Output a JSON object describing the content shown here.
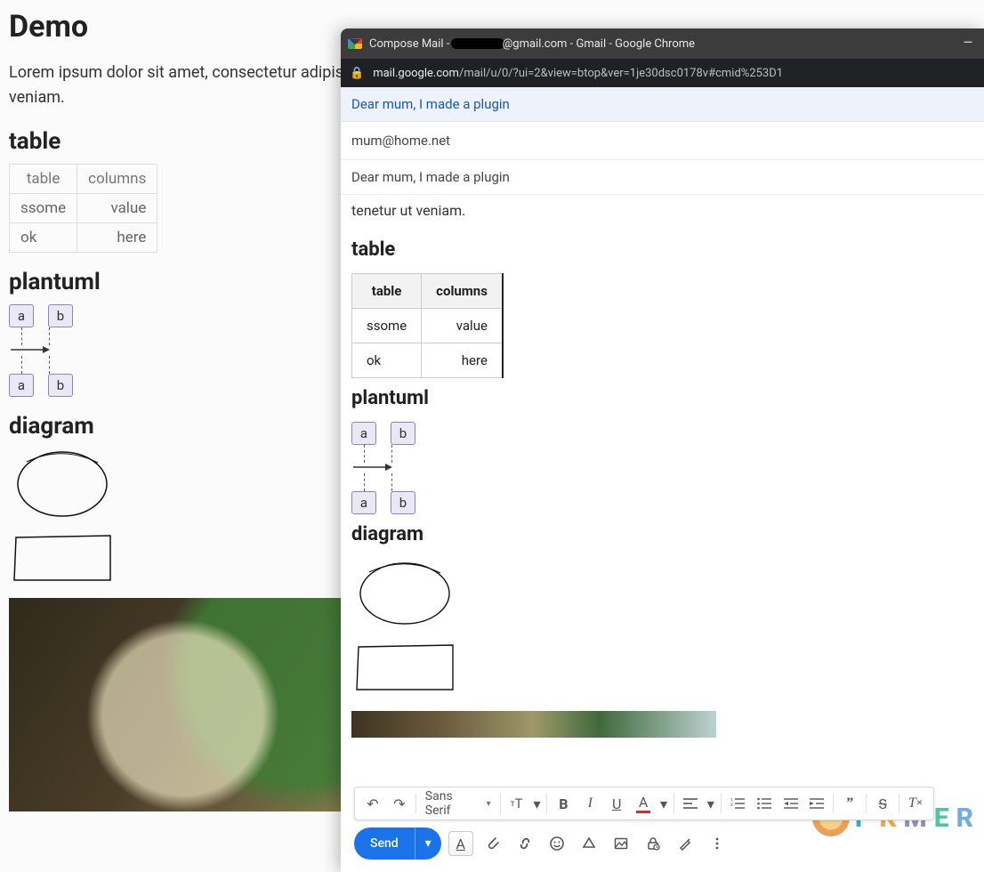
{
  "bg": {
    "title": "Demo",
    "paragraph": "Lorem ipsum dolor sit amet, consectetur adipisici non quaerat quasi quos saepe sequi totam volup laboriosam laudantium sit tenetur ut veniam.",
    "table_heading": "table",
    "table": {
      "headers": [
        "table",
        "columns"
      ],
      "rows": [
        [
          "ssome",
          "value"
        ],
        [
          "ok",
          "here"
        ]
      ]
    },
    "plantuml_heading": "plantuml",
    "plantuml_nodes": [
      "a",
      "b"
    ],
    "diagram_heading": "diagram"
  },
  "chrome": {
    "title_prefix": "Compose Mail - ",
    "title_domain": "@gmail.com",
    "title_suffix": " - Gmail - Google Chrome",
    "url_domain": "mail.google.com",
    "url_path": "/mail/u/0/?ui=2&view=btop&ver=1je30dsc0178v#cmid%253D1",
    "minimize": "–"
  },
  "compose": {
    "subject_header": "Dear mum, I made a plugin",
    "to": "mum@home.net",
    "subject": "Dear mum, I made a plugin",
    "body_trail": "tenetur ut veniam.",
    "table_heading": "table",
    "table": {
      "headers": [
        "table",
        "columns"
      ],
      "rows": [
        [
          "ssome",
          "value"
        ],
        [
          "ok",
          "here"
        ]
      ]
    },
    "plantuml_heading": "plantuml",
    "plantuml_nodes": [
      "a",
      "b"
    ],
    "diagram_heading": "diagram"
  },
  "toolbar": {
    "font_label": "Sans Serif",
    "send_label": "Send"
  },
  "icons": {
    "undo": "↶",
    "redo": "↷",
    "size": "тT",
    "size_caret": "▾",
    "bold": "B",
    "italic": "I",
    "underline": "U",
    "textcolor": "A",
    "align": "≡",
    "align_caret": "▾",
    "list_num": "≣",
    "list_bul": "•",
    "indent_dec": "⇤",
    "indent_inc": "⇥",
    "quote": "❝",
    "strike": "S̶",
    "clear": "Tx",
    "texthl": "A",
    "attach": "📎",
    "link": "🔗",
    "emoji": "☺",
    "drive": "△",
    "image": "🖼",
    "lock": "🔒",
    "pen": "✎",
    "more": "⋮"
  },
  "watermark": [
    "P",
    "K",
    "M",
    "E",
    "R"
  ]
}
